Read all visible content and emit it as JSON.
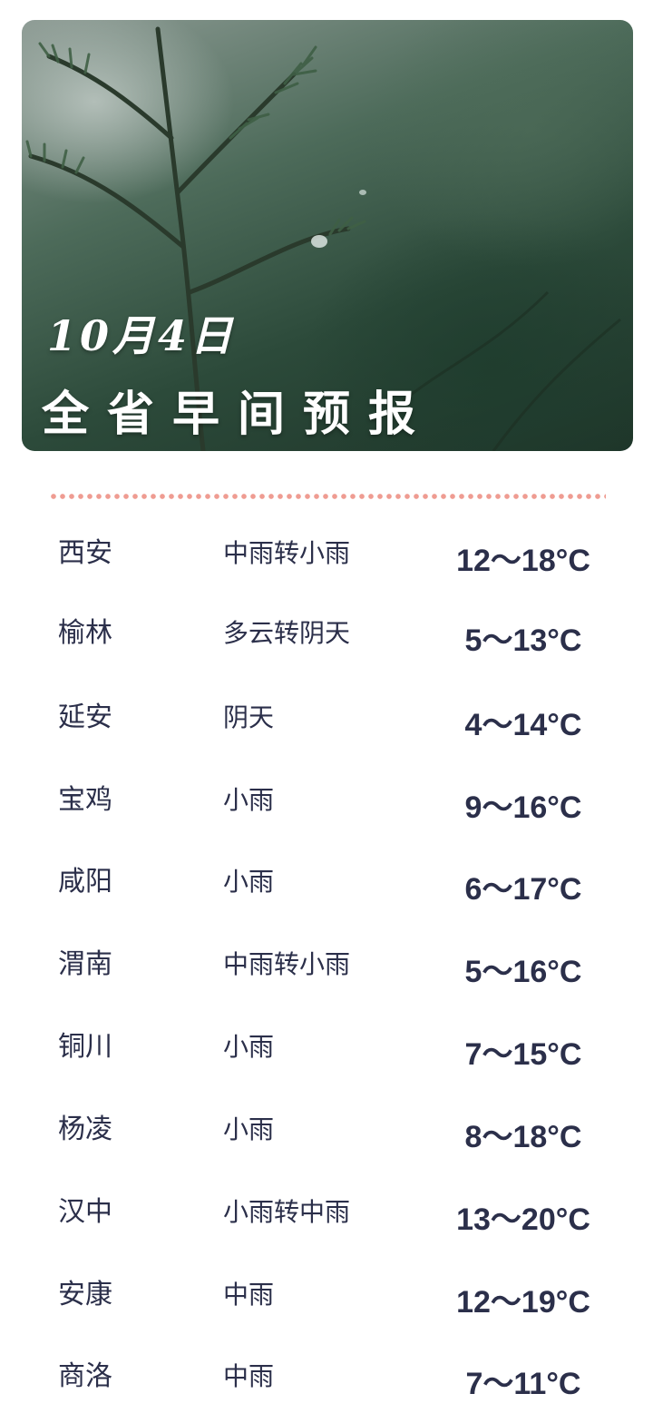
{
  "header": {
    "date": "10月4日",
    "title": "全省早间预报"
  },
  "forecast": [
    {
      "city": "西安",
      "weather": "中雨转小雨",
      "temp": "12～18°C"
    },
    {
      "city": "榆林",
      "weather": "多云转阴天",
      "temp": "5～13°C"
    },
    {
      "city": "延安",
      "weather": "阴天",
      "temp": "4～14°C"
    },
    {
      "city": "宝鸡",
      "weather": "小雨",
      "temp": "9～16°C"
    },
    {
      "city": "咸阳",
      "weather": "小雨",
      "temp": "6～17°C"
    },
    {
      "city": "渭南",
      "weather": "中雨转小雨",
      "temp": "5～16°C"
    },
    {
      "city": "铜川",
      "weather": "小雨",
      "temp": "7～15°C"
    },
    {
      "city": "杨凌",
      "weather": "小雨",
      "temp": "8～18°C"
    },
    {
      "city": "汉中",
      "weather": "小雨转中雨",
      "temp": "13～20°C"
    },
    {
      "city": "安康",
      "weather": "中雨",
      "temp": "12～19°C"
    },
    {
      "city": "商洛",
      "weather": "中雨",
      "temp": "7～11°C"
    }
  ],
  "colors": {
    "text": "#2b2f4a",
    "divider": "#ef9c92",
    "hero_dark": "#1e3529"
  },
  "icons": {
    "hero": "rainy-pine-branch-image"
  }
}
